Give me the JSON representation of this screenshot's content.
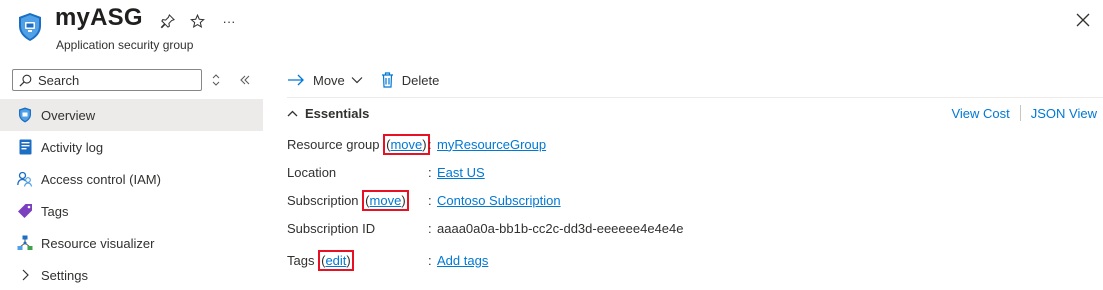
{
  "header": {
    "title": "myASG",
    "subtitle": "Application security group",
    "more_label": "···"
  },
  "sidebar": {
    "search": {
      "placeholder": "Search"
    },
    "items": [
      {
        "label": "Overview",
        "icon": "shield-icon",
        "active": true
      },
      {
        "label": "Activity log",
        "icon": "activity-log-icon"
      },
      {
        "label": "Access control (IAM)",
        "icon": "people-icon"
      },
      {
        "label": "Tags",
        "icon": "tag-icon"
      },
      {
        "label": "Resource visualizer",
        "icon": "visualizer-icon"
      },
      {
        "label": "Settings",
        "icon": "chevron-right-icon"
      }
    ]
  },
  "toolbar": {
    "move_label": "Move",
    "delete_label": "Delete"
  },
  "essentials": {
    "title": "Essentials",
    "view_cost": "View Cost",
    "json_view": "JSON View",
    "rows": {
      "resource_group": {
        "label": "Resource group",
        "action": "move",
        "value": "myResourceGroup"
      },
      "location": {
        "label": "Location",
        "value": "East US"
      },
      "subscription": {
        "label": "Subscription",
        "action": "move",
        "value": "Contoso Subscription"
      },
      "subscription_id": {
        "label": "Subscription ID",
        "value": "aaaa0a0a-bb1b-cc2c-dd3d-eeeeee4e4e4e"
      },
      "tags": {
        "label": "Tags",
        "action": "edit",
        "value": "Add tags"
      }
    }
  },
  "colors": {
    "accent": "#0078d4",
    "highlight": "#e81123",
    "active_bg": "#edebe9"
  }
}
